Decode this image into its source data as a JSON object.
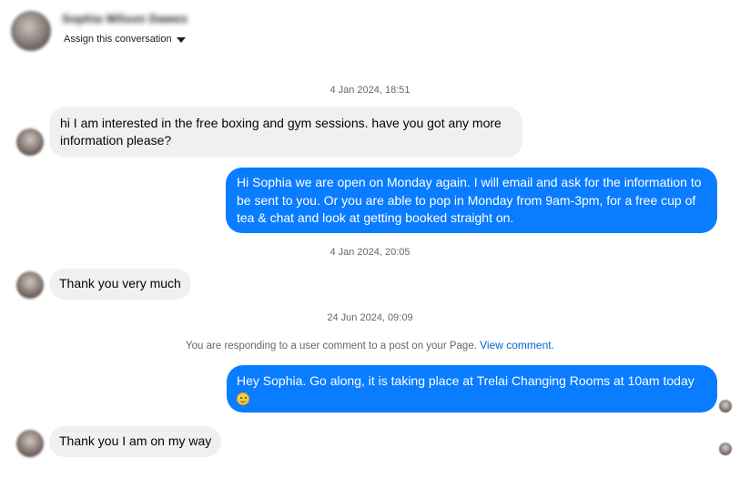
{
  "header": {
    "contact_name": "Sophia Wilson Dawes",
    "assign_label": "Assign this conversation"
  },
  "messages": [
    {
      "timestamp": "4 Jan 2024, 18:51"
    },
    {
      "text": "hi I am interested in the free boxing and gym sessions. have you got any more information please?"
    },
    {
      "text": "Hi Sophia we are open on Monday again. I will email and ask for the information to be sent to you. Or you are able to pop in Monday from 9am-3pm, for a free cup of tea & chat and look at getting booked straight on."
    },
    {
      "timestamp": "4 Jan 2024, 20:05"
    },
    {
      "text": "Thank you very much"
    },
    {
      "timestamp": "24 Jun 2024, 09:09"
    },
    {
      "notice": "You are responding to a user comment to a post on your Page.",
      "link": "View comment."
    },
    {
      "text": "Hey Sophia. Go along, it is taking place at Trelai Changing Rooms at 10am today",
      "emoji": "slightly-smiling-face-icon"
    },
    {
      "text": "Thank you I am on my way"
    }
  ],
  "colors": {
    "outgoing_bubble": "#0a7cff",
    "incoming_bubble": "#f0f0f0",
    "timestamp_text": "#65676b",
    "link": "#0064d1"
  }
}
